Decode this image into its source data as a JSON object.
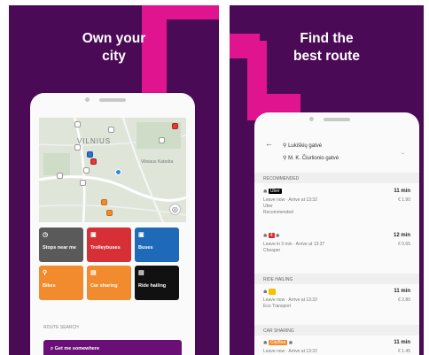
{
  "colors": {
    "panel_bg": "#4a0a55",
    "stripe": "#e0148f",
    "button": "#6a0f75"
  },
  "left": {
    "headline": [
      "Own your",
      "city"
    ],
    "map": {
      "city_label": "VILNIUS",
      "street_label": "Vilniaus Katedra"
    },
    "tiles": [
      {
        "label": "Stops near me",
        "color": "#5a5a5a",
        "icon": "clock-icon",
        "glyph": "◷"
      },
      {
        "label": "Trolleybuses",
        "color": "#d62f35",
        "icon": "trolleybus-icon",
        "glyph": "▣"
      },
      {
        "label": "Buses",
        "color": "#1f6ab8",
        "icon": "bus-icon",
        "glyph": "▣"
      },
      {
        "label": "Bikes",
        "color": "#f28a2e",
        "icon": "bike-icon",
        "glyph": "⚲"
      },
      {
        "label": "Car sharing",
        "color": "#f28a2e",
        "icon": "car-icon",
        "glyph": "▤"
      },
      {
        "label": "Ride hailing",
        "color": "#111111",
        "icon": "taxi-icon",
        "glyph": "▤"
      }
    ],
    "section_label": "ROUTE SEARCH",
    "search_button": "Get me somewhere"
  },
  "right": {
    "headline": [
      "Find the",
      "best route"
    ],
    "from": "Lukiškių gatvė",
    "to": "M. K. Čiurlionio gatvė",
    "sections": {
      "recommended": "RECOMMENDED",
      "ride_hailing": "RIDE HAILING",
      "car_sharing": "CAR SHARING"
    },
    "options": [
      {
        "badge": "Uber",
        "lines": [
          "Leave now · Arrive at 13:32",
          "Uber",
          "Recommended"
        ],
        "time": "11 min",
        "price": "€ 1.90"
      },
      {
        "badge": "4",
        "lines": [
          "Leave in 3 min · Arrive at 13:37",
          "Cheaper"
        ],
        "time": "12 min",
        "price": "€ 0.65"
      },
      {
        "badge": "",
        "lines": [
          "Leave now · Arrive at 13:32",
          "Eco Transport"
        ],
        "time": "11 min",
        "price": "€ 2.80"
      },
      {
        "badge": "CityBee",
        "lines": [
          "Leave now · Arrive at 13:32"
        ],
        "time": "11 min",
        "price": "€ 1.45"
      }
    ]
  }
}
